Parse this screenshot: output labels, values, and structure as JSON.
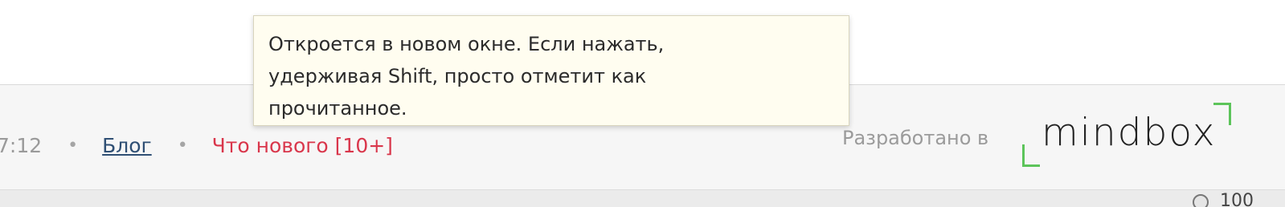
{
  "footer": {
    "time_fragment": "7:12",
    "separator": "•",
    "blog_label": "Блог",
    "whatsnew_label": "Что нового [10+]",
    "developed_by_label": "Разработано в",
    "logo_text": "mindbox"
  },
  "tooltip": {
    "lines": [
      "Откроется в новом окне. Если нажать,",
      "удерживая Shift, просто отметит как",
      "прочитанное."
    ]
  },
  "bottom_bar": {
    "partial_text": "100"
  },
  "colors": {
    "link_blue": "#2f4f74",
    "whatsnew_red": "#d9364b",
    "logo_green": "#5cc45a",
    "tooltip_bg": "#fffdf0"
  }
}
